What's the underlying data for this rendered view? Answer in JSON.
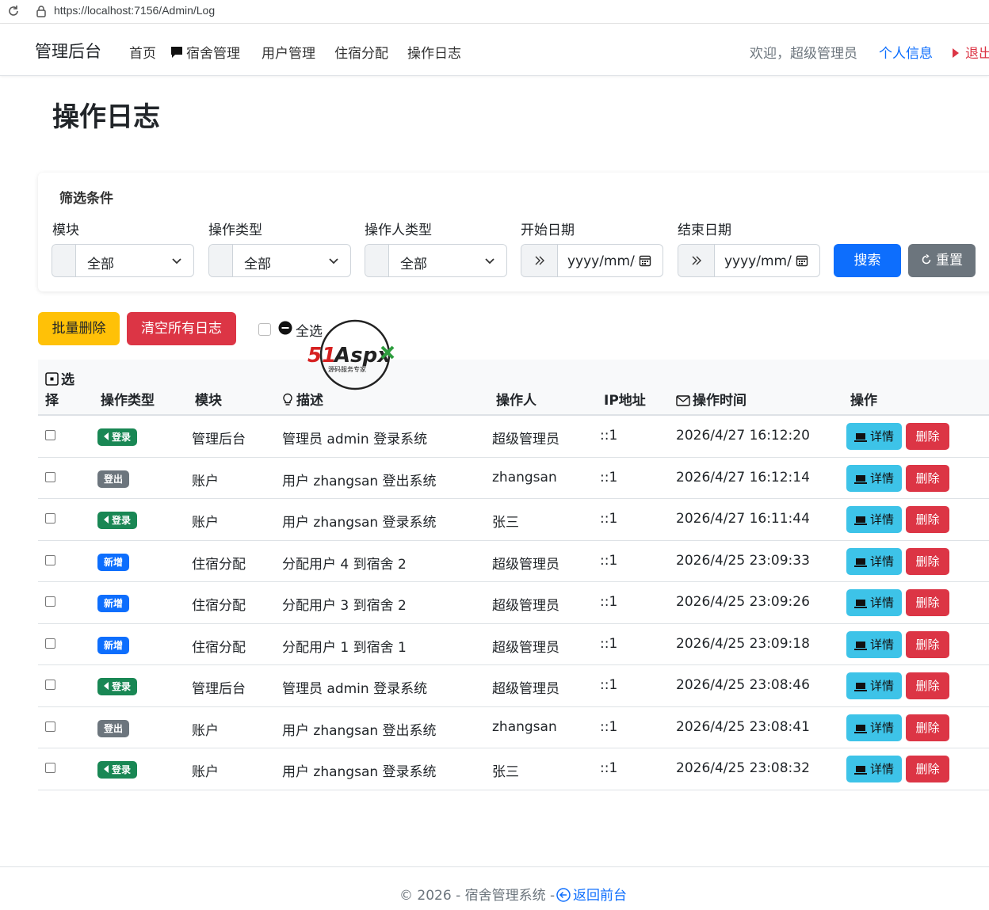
{
  "browser": {
    "url": "https://localhost:7156/Admin/Log"
  },
  "navbar": {
    "brand": "管理后台",
    "items": [
      {
        "label": "首页"
      },
      {
        "label": "宿舍管理",
        "icon": "chat-square-icon"
      },
      {
        "label": "用户管理"
      },
      {
        "label": "住宿分配"
      },
      {
        "label": "操作日志"
      }
    ],
    "welcome": "欢迎，超级管理员",
    "profile": "个人信息",
    "logout": "退出"
  },
  "page": {
    "title": "操作日志"
  },
  "filter": {
    "title": "筛选条件",
    "module_label": "模块",
    "module_value": "全部",
    "optype_label": "操作类型",
    "optype_value": "全部",
    "operator_label": "操作人类型",
    "operator_value": "全部",
    "start_label": "开始日期",
    "start_placeholder": "yyyy/mm/dd",
    "end_label": "结束日期",
    "end_placeholder": "yyyy/mm/dd",
    "search": "搜索",
    "reset": "重置"
  },
  "actions": {
    "batch_delete": "批量删除",
    "clear_all": "清空所有日志",
    "select_all": "全选"
  },
  "watermark": {
    "main": "51Aspx",
    "sub": "源码服务专家"
  },
  "table": {
    "headers": {
      "select_a": "选",
      "select_b": "择",
      "optype": "操作类型",
      "module": "模块",
      "desc": "描述",
      "operator": "操作人",
      "ip": "IP地址",
      "time": "操作时间",
      "action": "操作"
    },
    "detail_label": "详情",
    "delete_label": "删除",
    "rows": [
      {
        "type": "登录",
        "type_color": "#198754",
        "module": "管理后台",
        "desc": "管理员 admin 登录系统",
        "operator": "超级管理员",
        "ip": "::1",
        "time": "2026/4/27 16:12:20"
      },
      {
        "type": "登出",
        "type_color": "#6c757d",
        "module": "账户",
        "desc": "用户 zhangsan 登出系统",
        "operator": "zhangsan",
        "ip": "::1",
        "time": "2026/4/27 16:12:14"
      },
      {
        "type": "登录",
        "type_color": "#198754",
        "module": "账户",
        "desc": "用户 zhangsan 登录系统",
        "operator": "张三",
        "ip": "::1",
        "time": "2026/4/27 16:11:44"
      },
      {
        "type": "新增",
        "type_color": "#0d6efd",
        "module": "住宿分配",
        "desc": "分配用户 4 到宿舍 2",
        "operator": "超级管理员",
        "ip": "::1",
        "time": "2026/4/25 23:09:33"
      },
      {
        "type": "新增",
        "type_color": "#0d6efd",
        "module": "住宿分配",
        "desc": "分配用户 3 到宿舍 2",
        "operator": "超级管理员",
        "ip": "::1",
        "time": "2026/4/25 23:09:26"
      },
      {
        "type": "新增",
        "type_color": "#0d6efd",
        "module": "住宿分配",
        "desc": "分配用户 1 到宿舍 1",
        "operator": "超级管理员",
        "ip": "::1",
        "time": "2026/4/25 23:09:18"
      },
      {
        "type": "登录",
        "type_color": "#198754",
        "module": "管理后台",
        "desc": "管理员 admin 登录系统",
        "operator": "超级管理员",
        "ip": "::1",
        "time": "2026/4/25 23:08:46"
      },
      {
        "type": "登出",
        "type_color": "#6c757d",
        "module": "账户",
        "desc": "用户 zhangsan 登出系统",
        "operator": "zhangsan",
        "ip": "::1",
        "time": "2026/4/25 23:08:41"
      },
      {
        "type": "登录",
        "type_color": "#198754",
        "module": "账户",
        "desc": "用户 zhangsan 登录系统",
        "operator": "张三",
        "ip": "::1",
        "time": "2026/4/25 23:08:32"
      }
    ]
  },
  "footer": {
    "text": "© 2026 - 宿舍管理系统 - ",
    "link": "返回前台"
  }
}
